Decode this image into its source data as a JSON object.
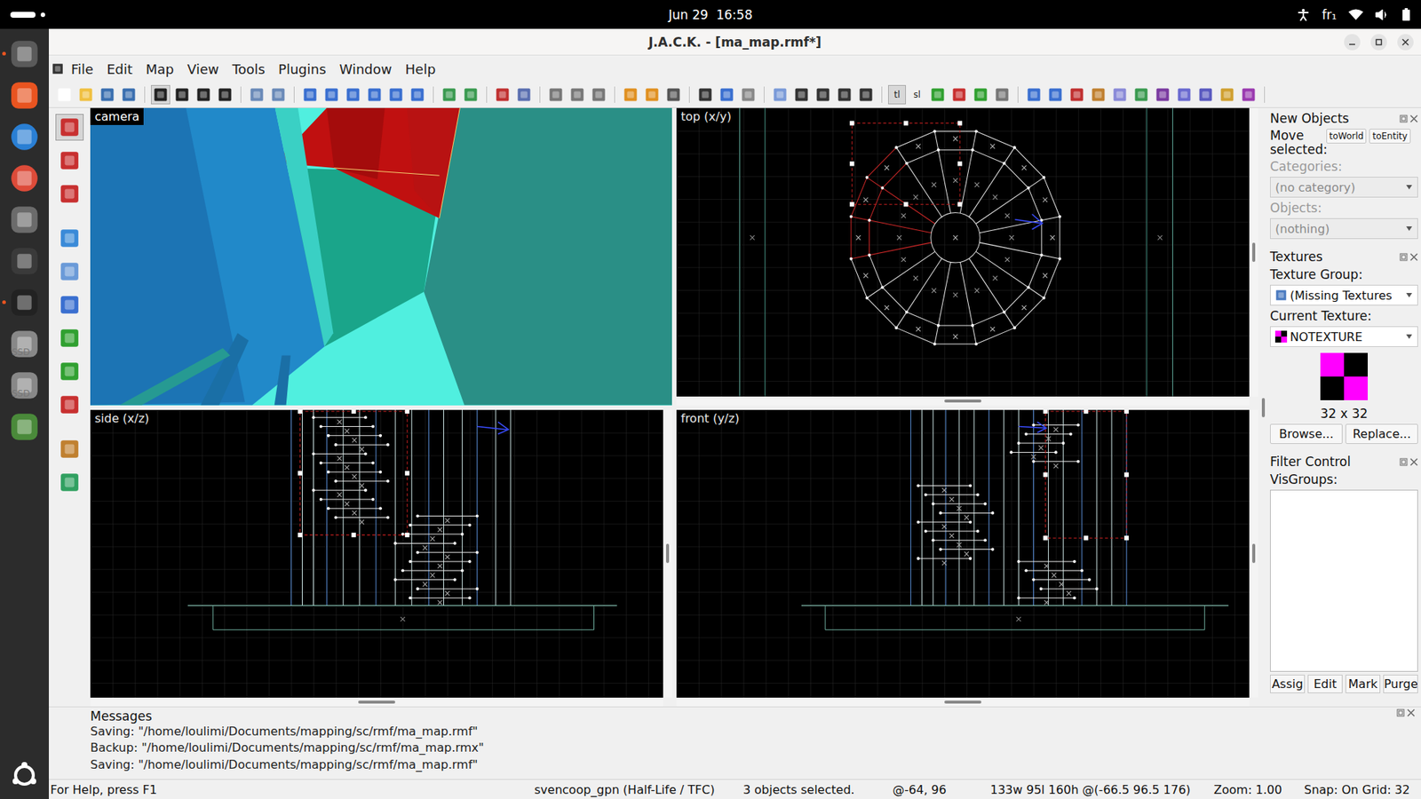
{
  "top_bar": {
    "clock": "Jun 29  16:58",
    "keyboard": "fr₁"
  },
  "dock": {
    "drive_labels": [
      "SSD",
      "SSD"
    ]
  },
  "window": {
    "title": "J.A.C.K. - [ma_map.rmf*]"
  },
  "menu": [
    "File",
    "Edit",
    "Map",
    "View",
    "Tools",
    "Plugins",
    "Window",
    "Help"
  ],
  "toolbar": {
    "text_buttons": [
      "tl",
      "sl"
    ]
  },
  "viewports": [
    {
      "label": "camera",
      "kind": "camera"
    },
    {
      "label": "top (x/y)",
      "kind": "top"
    },
    {
      "label": "side (x/z)",
      "kind": "side"
    },
    {
      "label": "front (y/z)",
      "kind": "front"
    }
  ],
  "new_objects": {
    "title": "New Objects",
    "move_label": "Move selected:",
    "move_buttons": [
      "toWorld",
      "toEntity"
    ],
    "categories_label": "Categories:",
    "categories_value": "(no category)",
    "categories_disabled": true,
    "objects_label": "Objects:",
    "objects_value": "(nothing)",
    "objects_disabled": true
  },
  "textures": {
    "title": "Textures",
    "group_label": "Texture Group:",
    "group_value": "(Missing Textures",
    "current_label": "Current Texture:",
    "current_value": "NOTEXTURE",
    "size": "32 x 32",
    "buttons": [
      "Browse...",
      "Replace..."
    ]
  },
  "filter": {
    "title": "Filter Control",
    "visgroups_label": "VisGroups:",
    "buttons": [
      "Assig",
      "Edit",
      "Mark",
      "Purge"
    ]
  },
  "messages": {
    "title": "Messages",
    "lines": [
      "Saving: \"/home/loulimi/Documents/mapping/sc/rmf/ma_map.rmf\"",
      "Backup: \"/home/loulimi/Documents/mapping/sc/rmf/ma_map.rmx\"",
      "Saving: \"/home/loulimi/Documents/mapping/sc/rmf/ma_map.rmf\""
    ]
  },
  "status_bar": {
    "help": "For Help, press F1",
    "game": "svencoop_gpn (Half-Life / TFC)",
    "selection": "3 objects selected.",
    "cursor": "@-64, 96",
    "dimensions": "133w 95l 160h @(-66.5 96.5 176)",
    "zoom": "Zoom: 1.00",
    "snap": "Snap: On Grid: 32"
  }
}
